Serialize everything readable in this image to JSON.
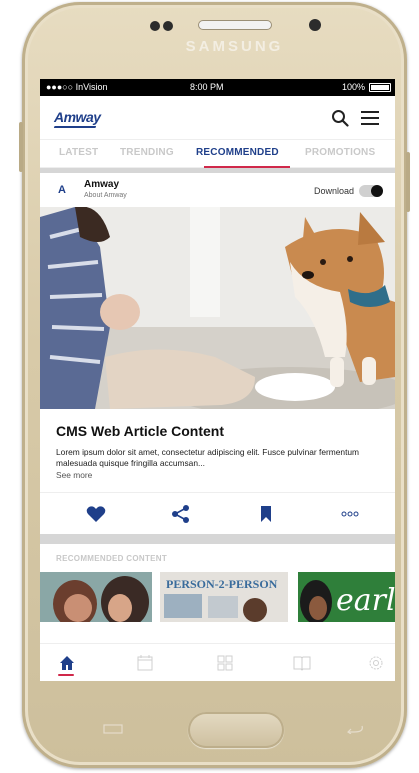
{
  "device": {
    "brand": "SAMSUNG"
  },
  "status_bar": {
    "carrier": "●●●○○ InVision",
    "time": "8:00 PM",
    "battery": "100%"
  },
  "app": {
    "logo": "Amway"
  },
  "tabs": [
    {
      "label": "LATEST",
      "active": false
    },
    {
      "label": "TRENDING",
      "active": false
    },
    {
      "label": "RECOMMENDED",
      "active": true
    },
    {
      "label": "PROMOTIONS",
      "active": false
    }
  ],
  "post": {
    "avatar_letter": "A",
    "author": "Amway",
    "author_sub": "About Amway",
    "download_label": "Download",
    "download_enabled": true,
    "title": "CMS Web Article Content",
    "body": "Lorem ipsum dolor sit amet, consectetur adipiscing elit. Fusce pulvinar fermentum malesuada quisque fringilla accumsan...",
    "see_more": "See more",
    "actions": [
      "heart-icon",
      "share-icon",
      "bookmark-icon",
      "more-icon"
    ]
  },
  "recommended": {
    "label": "RECOMMENDED CONTENT",
    "cards": [
      {
        "image": "people-photo"
      },
      {
        "image": "person-2-person-poster",
        "text": "PERSON-2-PERSON"
      },
      {
        "image": "learn-poster",
        "text": "earl"
      }
    ]
  },
  "bottom_nav": [
    "home-icon",
    "calendar-icon",
    "grid-icon",
    "book-icon",
    "settings-icon"
  ],
  "colors": {
    "brand_blue": "#1f3f8a",
    "accent_red": "#d0284a",
    "inactive_gray": "#c9c9c9"
  }
}
